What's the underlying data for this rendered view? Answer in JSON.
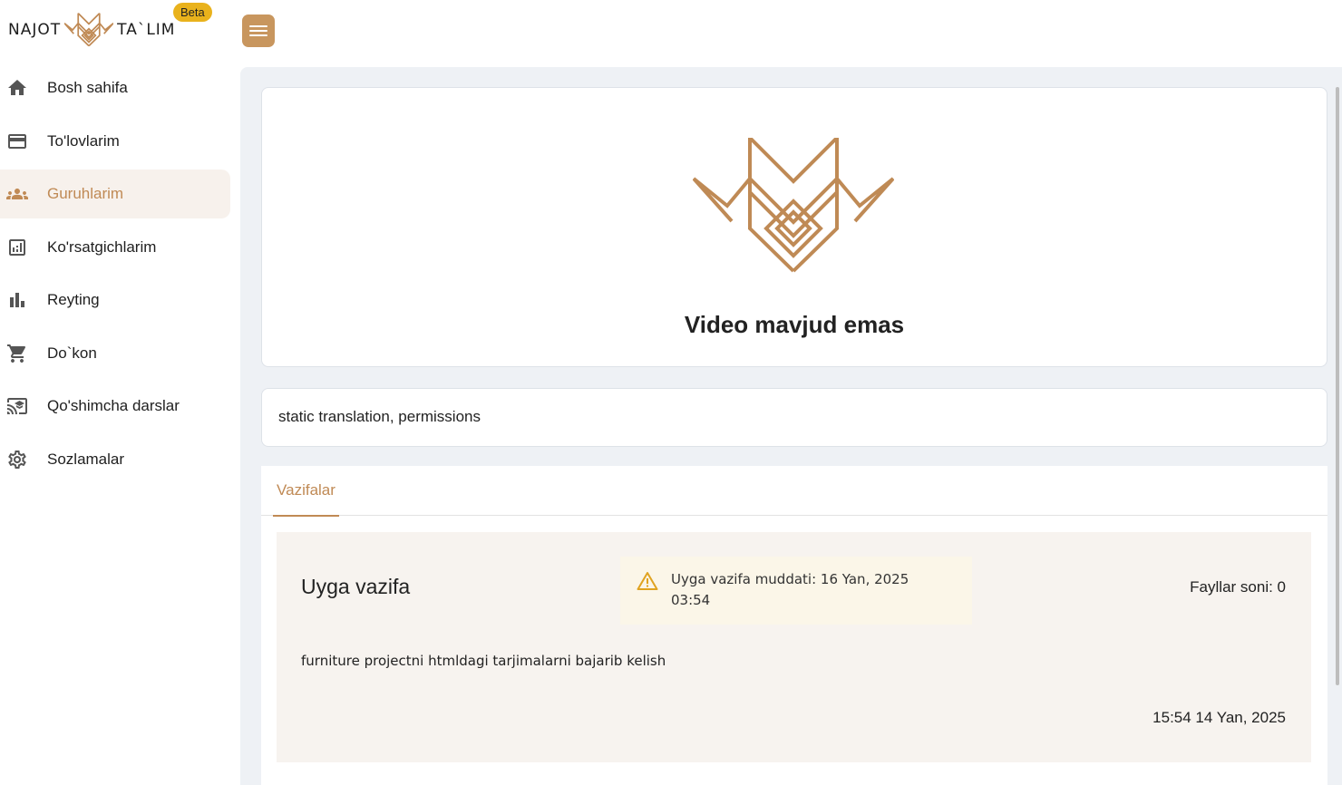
{
  "logo": {
    "left_word": "NAJOT",
    "right_word": "TA`LIM",
    "badge": "Beta"
  },
  "sidebar": {
    "items": [
      {
        "label": "Bosh sahifa",
        "icon": "home-icon",
        "active": false
      },
      {
        "label": "To'lovlarim",
        "icon": "credit-card-icon",
        "active": false
      },
      {
        "label": "Guruhlarim",
        "icon": "groups-icon",
        "active": true
      },
      {
        "label": "Ko'rsatgichlarim",
        "icon": "analytics-icon",
        "active": false
      },
      {
        "label": "Reyting",
        "icon": "bar-chart-icon",
        "active": false
      },
      {
        "label": "Do`kon",
        "icon": "cart-icon",
        "active": false
      },
      {
        "label": "Qo'shimcha darslar",
        "icon": "cast-lessons-icon",
        "active": false
      },
      {
        "label": "Sozlamalar",
        "icon": "gear-icon",
        "active": false
      }
    ]
  },
  "header": {
    "menu_icon": "hamburger-icon"
  },
  "video": {
    "message": "Video mavjud emas"
  },
  "lesson": {
    "description": "static translation, permissions"
  },
  "tabs": [
    {
      "label": "Vazifalar",
      "active": true
    }
  ],
  "task": {
    "title": "Uyga vazifa",
    "deadline": "Uyga vazifa muddati: 16 Yan, 2025 03:54",
    "files": "Fayllar soni: 0",
    "description": "furniture projectni htmldagi tarjimalarni bajarib kelish",
    "created": "15:54 14 Yan, 2025"
  },
  "colors": {
    "accent": "#c08a55",
    "active_bg": "#f7f1ec",
    "badge": "#e9b21c",
    "warning": "#e0a321",
    "main_bg": "#eef1f5"
  }
}
